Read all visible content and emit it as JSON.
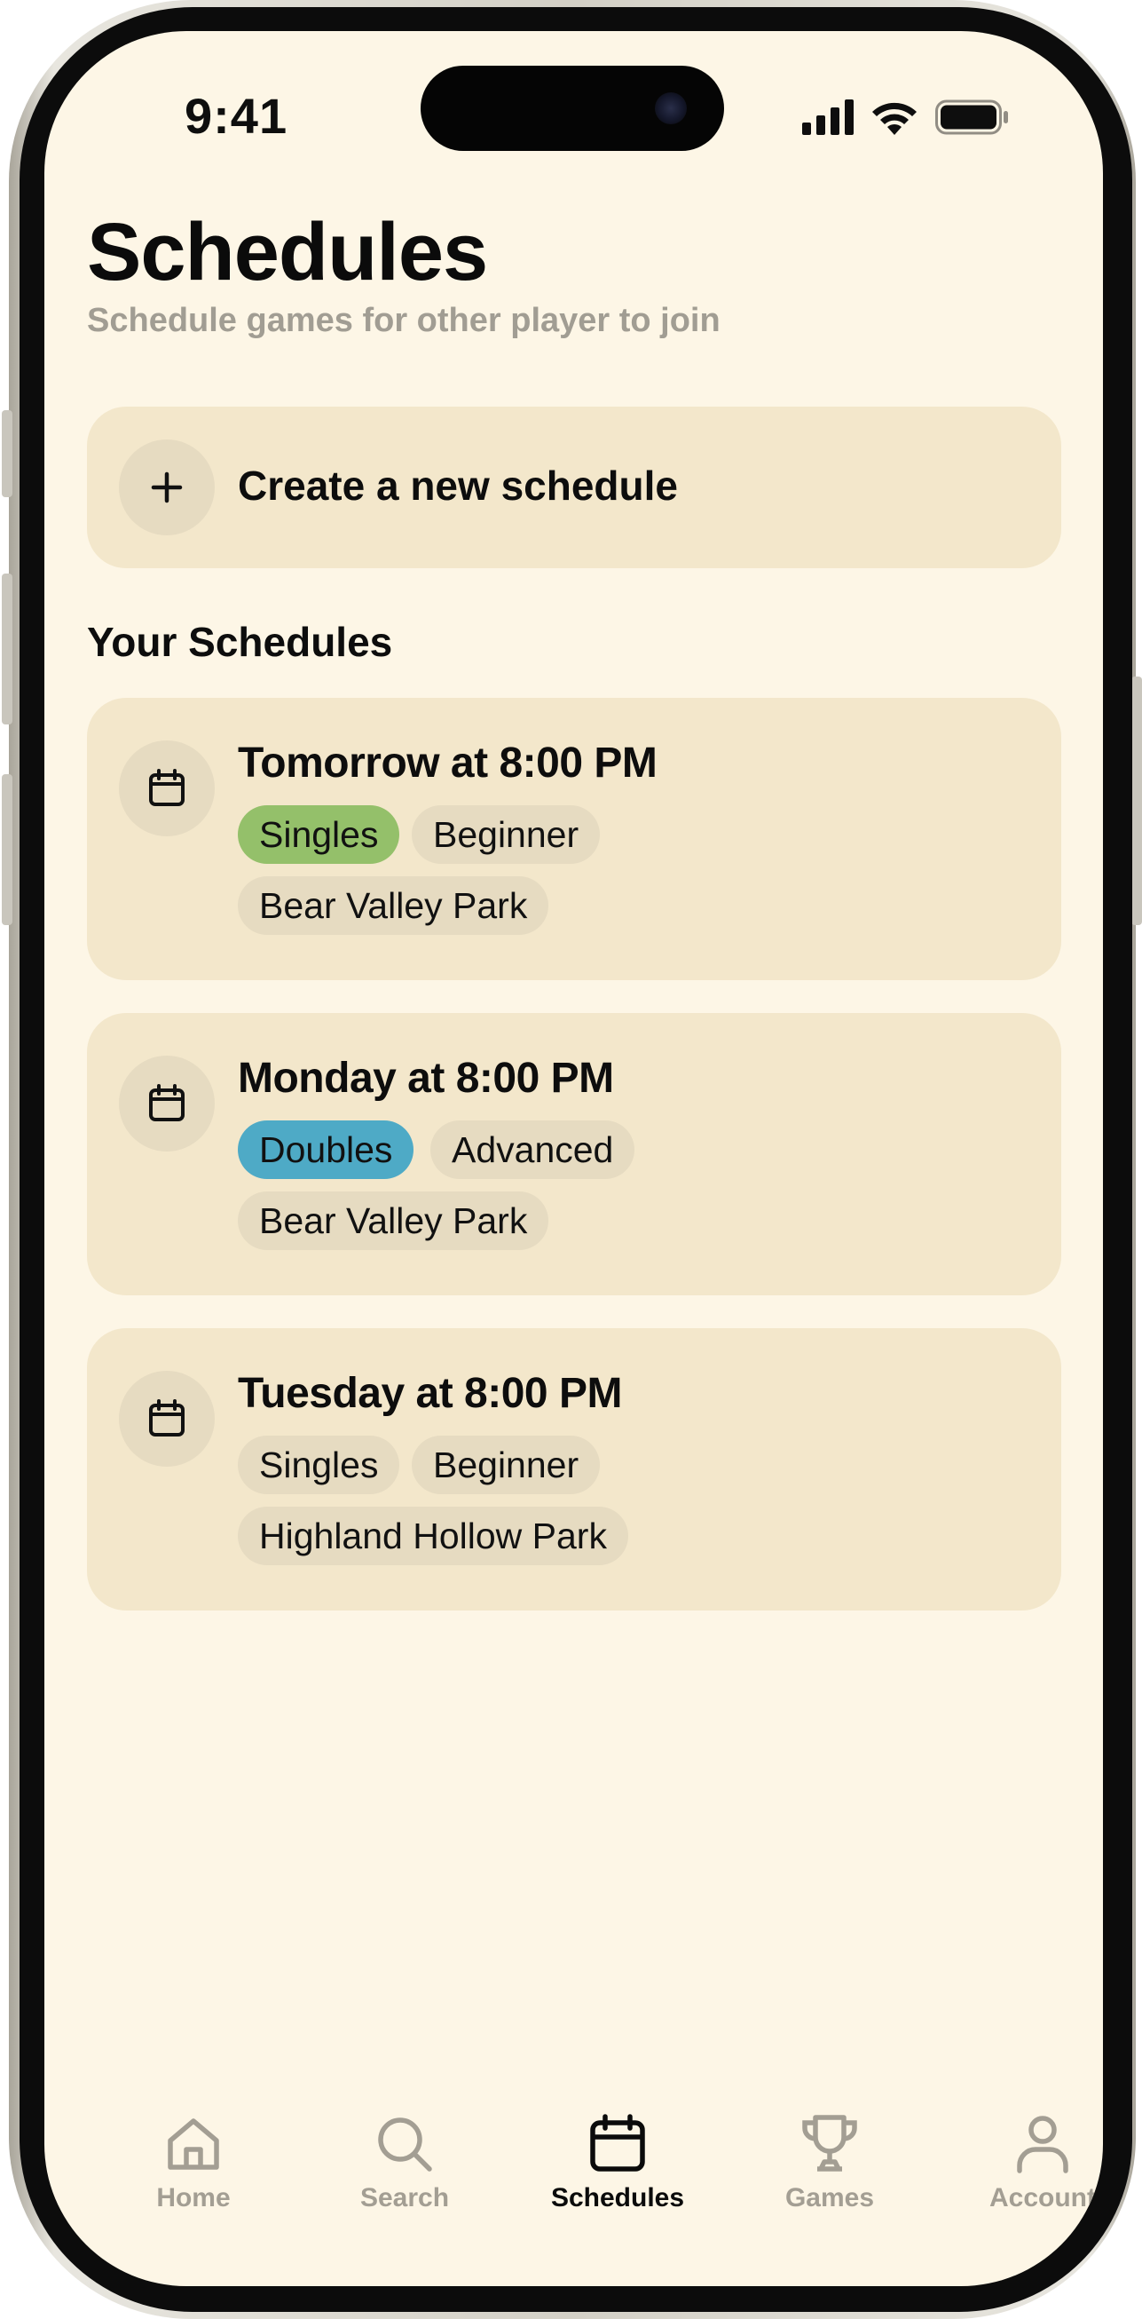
{
  "status_bar": {
    "time": "9:41"
  },
  "header": {
    "title": "Schedules",
    "subtitle": "Schedule games for other player to join"
  },
  "create": {
    "label": "Create a new schedule",
    "icon": "plus-icon"
  },
  "section": {
    "title": "Your Schedules"
  },
  "schedules": [
    {
      "title": "Tomorrow at 8:00 PM",
      "type": "Singles",
      "level": "Beginner",
      "location": "Bear Valley Park",
      "type_color": "#94c06a"
    },
    {
      "title": "Monday at 8:00 PM",
      "type": "Doubles",
      "level": "Advanced",
      "location": "Bear Valley Park",
      "type_color": "#4eaac6"
    },
    {
      "title": "Tuesday at 8:00 PM",
      "type": "Singles",
      "level": "Beginner",
      "location": "Highland Hollow Park",
      "type_color": "#e6dbc1"
    }
  ],
  "tabbar": {
    "items": [
      {
        "label": "Home",
        "icon": "home-icon",
        "active": false
      },
      {
        "label": "Search",
        "icon": "search-icon",
        "active": false
      },
      {
        "label": "Schedules",
        "icon": "calendar-icon",
        "active": true
      },
      {
        "label": "Games",
        "icon": "trophy-icon",
        "active": false
      },
      {
        "label": "Account",
        "icon": "person-icon",
        "active": false
      }
    ]
  },
  "colors": {
    "background": "#fdf6e6",
    "card": "#f3e7cb",
    "chip": "#e6dbc1",
    "singles_highlight": "#94c06a",
    "doubles_highlight": "#4eaac6",
    "muted_text": "#a19d93"
  }
}
